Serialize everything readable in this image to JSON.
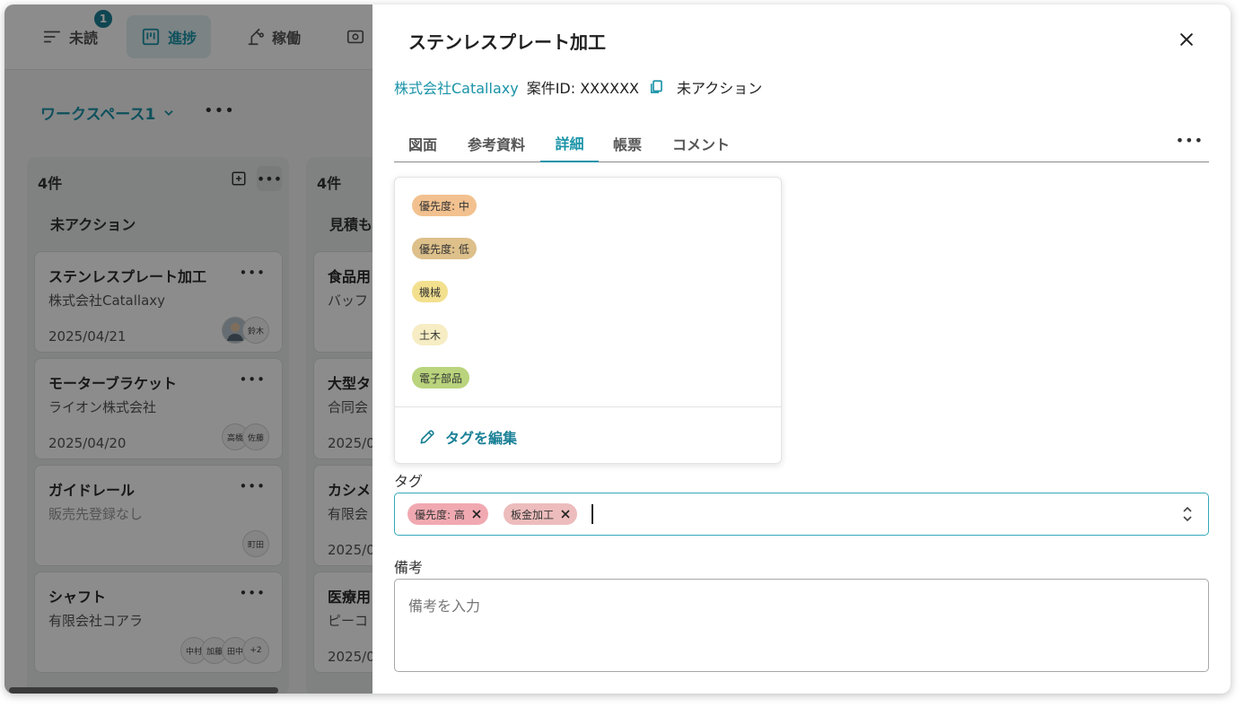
{
  "nav": {
    "items": [
      {
        "label": "未読",
        "icon": "list-icon"
      },
      {
        "label": "進捗",
        "icon": "board-icon"
      },
      {
        "label": "稼働",
        "icon": "machine-icon"
      }
    ],
    "unread_badge": "1"
  },
  "workspace": {
    "name": "ワークスペース1"
  },
  "columns": [
    {
      "count": "4件",
      "title": "未アクション",
      "cards": [
        {
          "title": "ステンレスプレート加工",
          "company": "株式会社Catallaxy",
          "date": "2025/04/21",
          "assignees": [
            "鈴木"
          ]
        },
        {
          "title": "モーターブラケット",
          "company": "ライオン株式会社",
          "date": "2025/04/20",
          "assignees": [
            "高橋",
            "佐藤"
          ]
        },
        {
          "title": "ガイドレール",
          "company": "販売先登録なし",
          "date": "",
          "assignees": [
            "町田"
          ]
        },
        {
          "title": "シャフト",
          "company": "有限会社コアラ",
          "date": "",
          "assignees": [
            "中村",
            "加藤",
            "田中",
            "+2"
          ]
        }
      ]
    },
    {
      "count": "4件",
      "title": "見積も",
      "cards": [
        {
          "title": "食品用",
          "company": "バッフ",
          "date": ""
        },
        {
          "title": "大型タ",
          "company": "合同会",
          "date": "2025/0"
        },
        {
          "title": "カシメ",
          "company": "有限会",
          "date": "2025/0"
        },
        {
          "title": "医療用",
          "company": "ピーコ",
          "date": "2025/0"
        }
      ]
    }
  ],
  "drawer": {
    "title": "ステンレスプレート加工",
    "company": "株式会社Catallaxy",
    "case_id": "案件ID: XXXXXX",
    "status": "未アクション",
    "tabs": [
      "図面",
      "参考資料",
      "詳細",
      "帳票",
      "コメント"
    ],
    "active_tab": "詳細",
    "tag_dropdown": {
      "options": [
        {
          "label": "優先度: 中",
          "color": "#f2c18f"
        },
        {
          "label": "優先度: 低",
          "color": "#ddc08a"
        },
        {
          "label": "機械",
          "color": "#f3e08e"
        },
        {
          "label": "土木",
          "color": "#f7edc4"
        },
        {
          "label": "電子部品",
          "color": "#b9d47c"
        }
      ],
      "edit_label": "タグを編集"
    },
    "tags_label": "タグ",
    "selected_tags": [
      {
        "label": "優先度: 高",
        "color": "#f1a9b1"
      },
      {
        "label": "板金加工",
        "color": "#edbcbc"
      }
    ],
    "notes_label": "備考",
    "notes_placeholder": "備考を入力"
  },
  "colors": {
    "accent": "#1a93a8",
    "accent_dark": "#1a8096"
  }
}
